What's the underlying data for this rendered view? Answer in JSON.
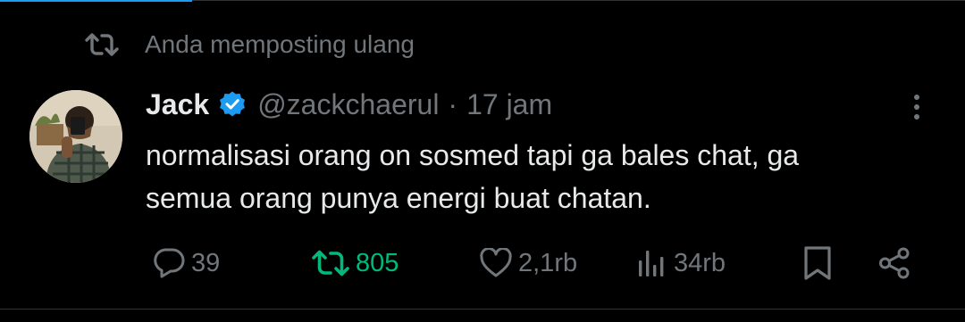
{
  "repost_context": {
    "text": "Anda memposting ulang"
  },
  "post": {
    "author": {
      "display_name": "Jack",
      "handle": "@zackchaerul",
      "verified": true
    },
    "separator": "·",
    "time": "17 jam",
    "text_line1": "normalisasi orang on sosmed tapi ga bales chat, ga",
    "text_line2": "semua orang punya energi buat chatan."
  },
  "actions": {
    "replies": "39",
    "reposts": "805",
    "likes": "2,1rb",
    "views": "34rb"
  },
  "icons": [
    "repost-icon",
    "verified-badge-icon",
    "more-icon",
    "reply-icon",
    "repost-icon",
    "like-icon",
    "views-icon",
    "bookmark-icon",
    "share-icon"
  ],
  "colors": {
    "background": "#000000",
    "text": "#e7e9ea",
    "muted": "#71767b",
    "reposted": "#00ba7c",
    "verified": "#1d9bf0"
  }
}
